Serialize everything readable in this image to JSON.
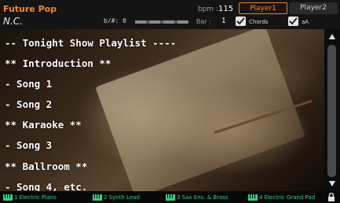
{
  "header": {
    "song_title": "Future Pop",
    "bpm_label": "bpm :",
    "bpm_value": "115",
    "player1_label": "Player1",
    "player2_label": "Player2",
    "chord": "N.C.",
    "transpose_label": "b/#:",
    "transpose_value": "0",
    "bar_label": "Bar :",
    "bar_value": "1",
    "chords_label": "Chords",
    "aa_label": "aA"
  },
  "lyrics": [
    "-- Tonight Show Playlist ----",
    "** Introduction **",
    "- Song 1",
    "- Song 2",
    "** Karaoke **",
    "- Song 3",
    "** Ballroom **",
    "- Song 4, etc."
  ],
  "tracks": [
    {
      "label": "1 Electric Piano"
    },
    {
      "label": "2  Synth Lead"
    },
    {
      "label": "3  Sax Ens. & Brass"
    },
    {
      "label": "4  Electric Grand Pad"
    }
  ],
  "colors": {
    "accent": "#ef8a2a",
    "track_text": "#35d07a",
    "lyric_text": "#ffffff"
  },
  "icons": {
    "checkbox": "check-icon",
    "keyboard": "keyboard-icon",
    "lock": "lock-icon"
  }
}
